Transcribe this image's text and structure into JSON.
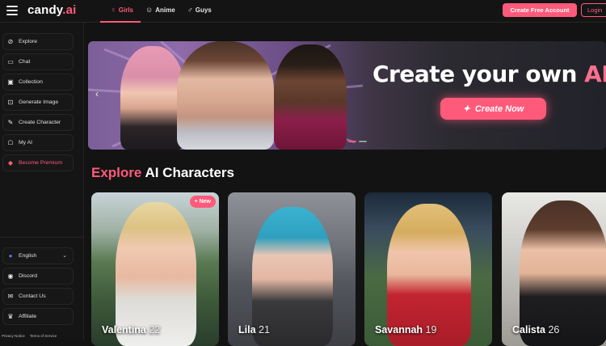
{
  "header": {
    "logo_main": "candy",
    "logo_accent": ".ai",
    "tabs": [
      {
        "label": "Girls",
        "icon": "female-symbol-icon",
        "active": true
      },
      {
        "label": "Anime",
        "icon": "anime-face-icon",
        "active": false
      },
      {
        "label": "Guys",
        "icon": "male-symbol-icon",
        "active": false
      }
    ],
    "create_account_label": "Create Free Account",
    "login_label": "Login"
  },
  "sidebar": {
    "items": [
      {
        "label": "Explore",
        "icon": "compass-icon"
      },
      {
        "label": "Chat",
        "icon": "chat-bubble-icon"
      },
      {
        "label": "Collection",
        "icon": "image-gallery-icon"
      },
      {
        "label": "Generate Image",
        "icon": "sparkle-image-icon"
      },
      {
        "label": "Create Character",
        "icon": "magic-wand-icon"
      },
      {
        "label": "My AI",
        "icon": "robot-icon"
      },
      {
        "label": "Become Premium",
        "icon": "diamond-icon"
      }
    ],
    "bottom_items": [
      {
        "label": "English",
        "icon": "us-flag-icon"
      },
      {
        "label": "Discord",
        "icon": "discord-icon"
      },
      {
        "label": "Contact Us",
        "icon": "mail-icon"
      },
      {
        "label": "Affiliate",
        "icon": "trophy-icon"
      }
    ],
    "footer": {
      "privacy": "Privacy Notice",
      "terms": "Terms of Service"
    }
  },
  "banner": {
    "title_main": "Create your own ",
    "title_accent": "AI Girlfriend",
    "cta_label": "Create Now",
    "slide_count": 3,
    "active_slide": 1
  },
  "section": {
    "title_accent": "Explore",
    "title_main": " AI Characters"
  },
  "characters": [
    {
      "name": "Valentina",
      "age": "22",
      "badge": "+ New"
    },
    {
      "name": "Lila",
      "age": "21",
      "badge": ""
    },
    {
      "name": "Savannah",
      "age": "19",
      "badge": ""
    },
    {
      "name": "Calista",
      "age": "26",
      "badge": ""
    }
  ],
  "colors": {
    "accent": "#ff5a7a",
    "background": "#131313"
  }
}
